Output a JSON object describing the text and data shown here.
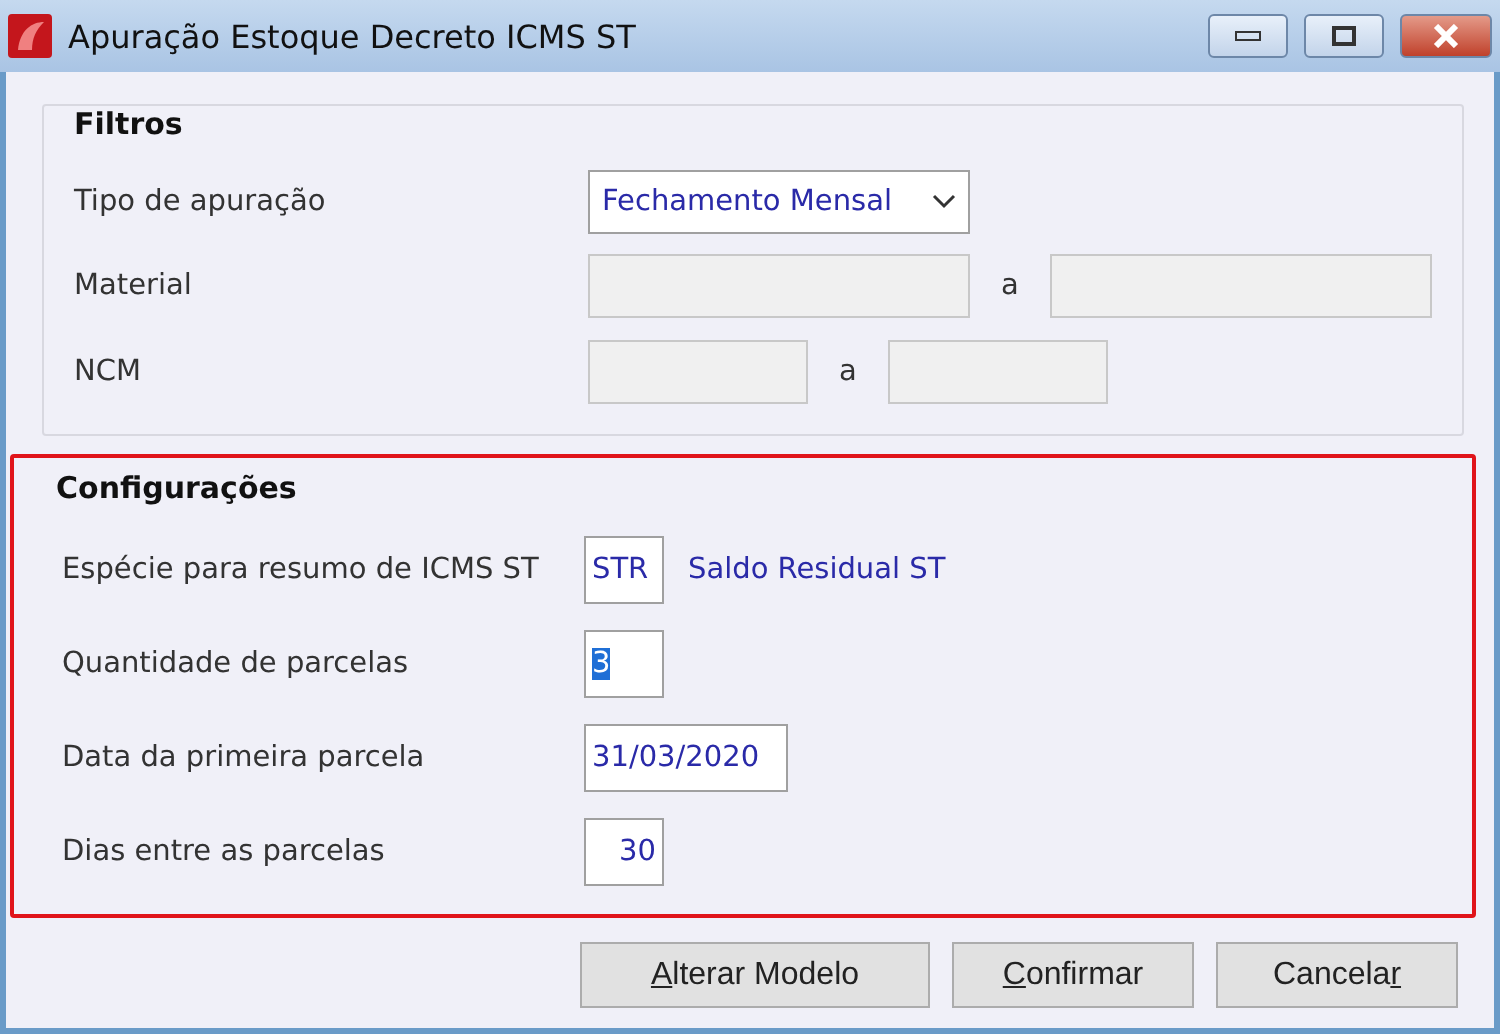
{
  "window": {
    "title": "Apuração Estoque Decreto ICMS ST"
  },
  "filters": {
    "title": "Filtros",
    "tipo": {
      "label": "Tipo de apuração",
      "value": "Fechamento Mensal"
    },
    "ranges": [
      {
        "label": "Material",
        "separator": "a",
        "disabled": true
      },
      {
        "label": "NCM",
        "separator": "a",
        "disabled": true
      }
    ]
  },
  "config": {
    "title": "Configurações",
    "highlighted": true,
    "rows": [
      {
        "label": "Espécie para resumo de ICMS ST",
        "value": "STR",
        "selected": false,
        "description": "Saldo Residual ST"
      },
      {
        "label": "Quantidade de parcelas",
        "value": "3",
        "selected": true
      },
      {
        "label": "Data da primeira parcela",
        "value": "31/03/2020",
        "selected": false
      },
      {
        "label": "Dias entre as parcelas",
        "value": "30",
        "selected": false
      }
    ]
  },
  "buttons": [
    {
      "key": "A",
      "post": "lterar Modelo"
    },
    {
      "key": "C",
      "post": "onfirmar"
    },
    {
      "pre": "Cancela",
      "key": "r"
    }
  ]
}
